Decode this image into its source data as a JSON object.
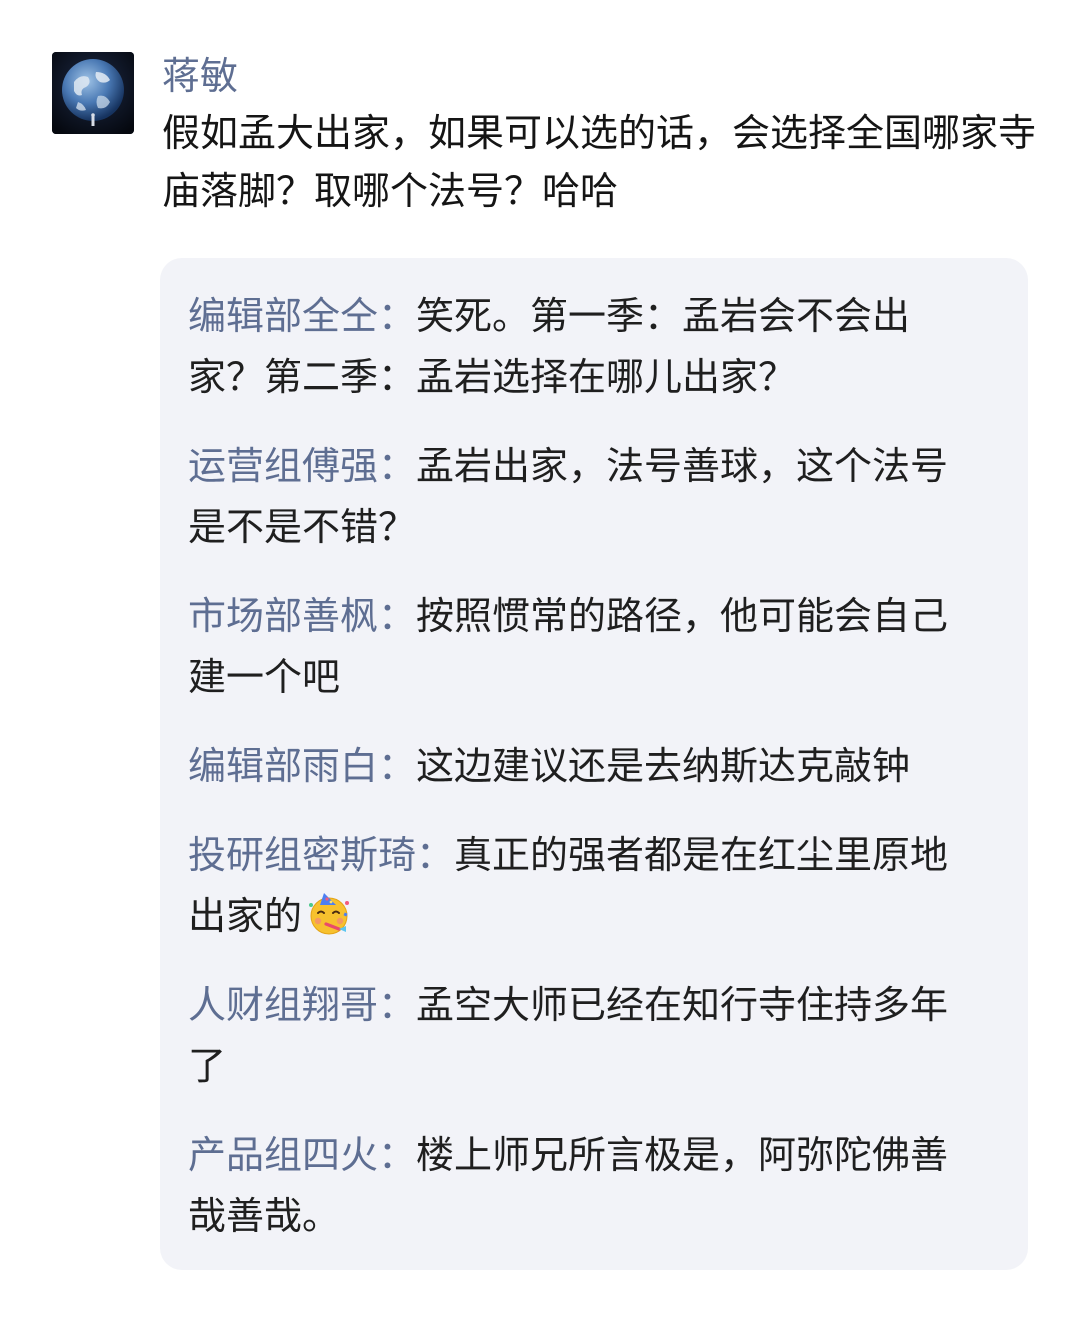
{
  "post": {
    "author": "蒋敏",
    "avatar_icon": "earth-avatar-icon",
    "text": "假如孟大出家，如果可以选的话，会选择全国哪家寺庙落脚？取哪个法号？哈哈"
  },
  "comments": [
    {
      "name": "编辑部全仝：",
      "text": "笑死。第一季：孟岩会不会出家？第二季：孟岩选择在哪儿出家？"
    },
    {
      "name": "运营组傅强：",
      "text": "孟岩出家，法号善球，这个法号是不是不错？"
    },
    {
      "name": "市场部善枫：",
      "text": "按照惯常的路径，他可能会自己建一个吧"
    },
    {
      "name": "编辑部雨白：",
      "text": "这边建议还是去纳斯达克敲钟"
    },
    {
      "name": "投研组密斯琦：",
      "text": "真正的强者都是在红尘里原地出家的",
      "emoji": "partying-face-emoji-icon"
    },
    {
      "name": "人财组翔哥：",
      "text": "孟空大师已经在知行寺住持多年了"
    },
    {
      "name": "产品组四火：",
      "text": "楼上师兄所言极是，阿弥陀佛善哉善哉。"
    }
  ],
  "colors": {
    "name": "#5e6e92",
    "text": "#151515",
    "bubble": "#f2f3f8"
  }
}
